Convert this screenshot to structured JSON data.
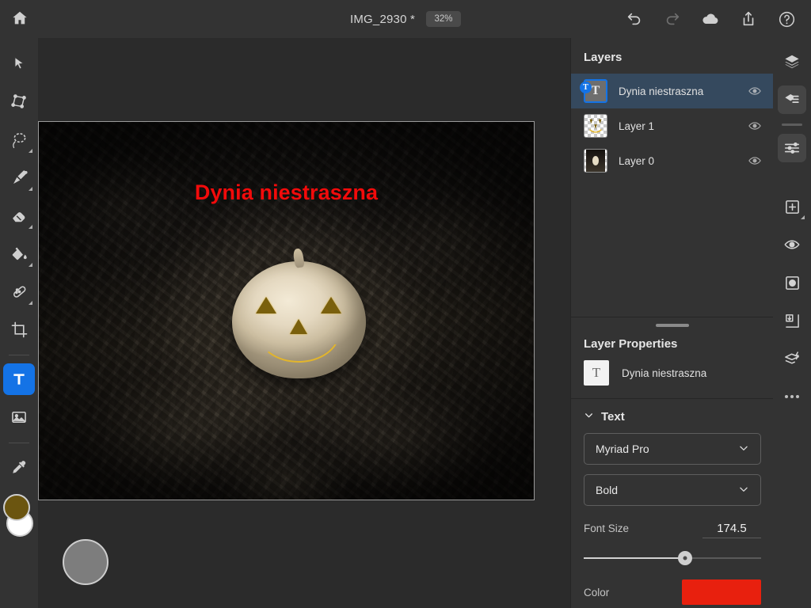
{
  "app": {
    "accent_blue": "#1473e6",
    "panel_bg": "#333333",
    "canvas_bg": "#2b2b2b",
    "selection_blue": "#35495e"
  },
  "topbar": {
    "home_icon": "home-icon",
    "document_title": "IMG_2930 *",
    "zoom_level": "32%",
    "actions": [
      {
        "name": "undo-icon",
        "label": "Undo",
        "enabled": true
      },
      {
        "name": "redo-icon",
        "label": "Redo",
        "enabled": false
      },
      {
        "name": "cloud-icon",
        "label": "Cloud",
        "enabled": true
      },
      {
        "name": "share-icon",
        "label": "Share",
        "enabled": true
      },
      {
        "name": "help-icon",
        "label": "Help",
        "enabled": true
      }
    ]
  },
  "toolbar": {
    "tools": [
      {
        "name": "select-tool",
        "label": "Select",
        "active": false,
        "has_flyout": false
      },
      {
        "name": "transform-tool",
        "label": "Transform",
        "active": false,
        "has_flyout": false
      },
      {
        "name": "lasso-tool",
        "label": "Lasso Select",
        "active": false,
        "has_flyout": true
      },
      {
        "name": "brush-tool",
        "label": "Brush",
        "active": false,
        "has_flyout": true
      },
      {
        "name": "eraser-tool",
        "label": "Eraser",
        "active": false,
        "has_flyout": true
      },
      {
        "name": "fill-tool",
        "label": "Paint Bucket",
        "active": false,
        "has_flyout": true
      },
      {
        "name": "heal-tool",
        "label": "Spot Healing",
        "active": false,
        "has_flyout": true
      },
      {
        "name": "crop-tool",
        "label": "Crop",
        "active": false,
        "has_flyout": false
      },
      {
        "name": "text-tool",
        "label": "Text",
        "active": true,
        "has_flyout": false
      },
      {
        "name": "place-image-tool",
        "label": "Place Image",
        "active": false,
        "has_flyout": false
      },
      {
        "name": "eyedropper-tool",
        "label": "Eyedropper",
        "active": false,
        "has_flyout": false
      }
    ],
    "foreground_color": "#6b5510",
    "background_color": "#ffffff"
  },
  "canvas": {
    "overlay_text": "Dynia niestraszna",
    "overlay_text_color": "#f20b0b",
    "touch_cursor": "brush-size-preview"
  },
  "layers_panel": {
    "title": "Layers",
    "items": [
      {
        "name": "Dynia niestraszna",
        "type": "text",
        "selected": true,
        "visible": true
      },
      {
        "name": "Layer 1",
        "type": "raster",
        "selected": false,
        "visible": true
      },
      {
        "name": "Layer 0",
        "type": "raster",
        "selected": false,
        "visible": true
      }
    ]
  },
  "layer_properties": {
    "title": "Layer Properties",
    "layer_name": "Dynia niestraszna",
    "layer_thumb_glyph": "T",
    "sections": {
      "text": {
        "heading": "Text",
        "font_family": "Myriad Pro",
        "font_style": "Bold",
        "font_size_label": "Font Size",
        "font_size_value": "174.5",
        "font_size_slider_percent": 57,
        "color_label": "Color",
        "color_value": "#e8200e"
      }
    }
  },
  "right_rail": {
    "buttons": [
      {
        "name": "layers-icon",
        "label": "Layers",
        "selected": false,
        "has_flyout": false
      },
      {
        "name": "layer-properties-icon",
        "label": "Layer Properties",
        "selected": true,
        "has_flyout": false
      },
      {
        "name": "adjustments-icon",
        "label": "Adjustments",
        "selected": true,
        "has_flyout": false
      },
      {
        "name": "add-layer-icon",
        "label": "Add Layer",
        "selected": false,
        "has_flyout": true
      },
      {
        "name": "visibility-icon",
        "label": "Toggle Visibility",
        "selected": false,
        "has_flyout": false
      },
      {
        "name": "mask-icon",
        "label": "Add Mask",
        "selected": false,
        "has_flyout": false
      },
      {
        "name": "merge-down-icon",
        "label": "Merge Down",
        "selected": false,
        "has_flyout": false
      },
      {
        "name": "effects-icon",
        "label": "Layer Effects",
        "selected": false,
        "has_flyout": false
      },
      {
        "name": "more-options-icon",
        "label": "More",
        "selected": false,
        "has_flyout": false
      }
    ]
  }
}
